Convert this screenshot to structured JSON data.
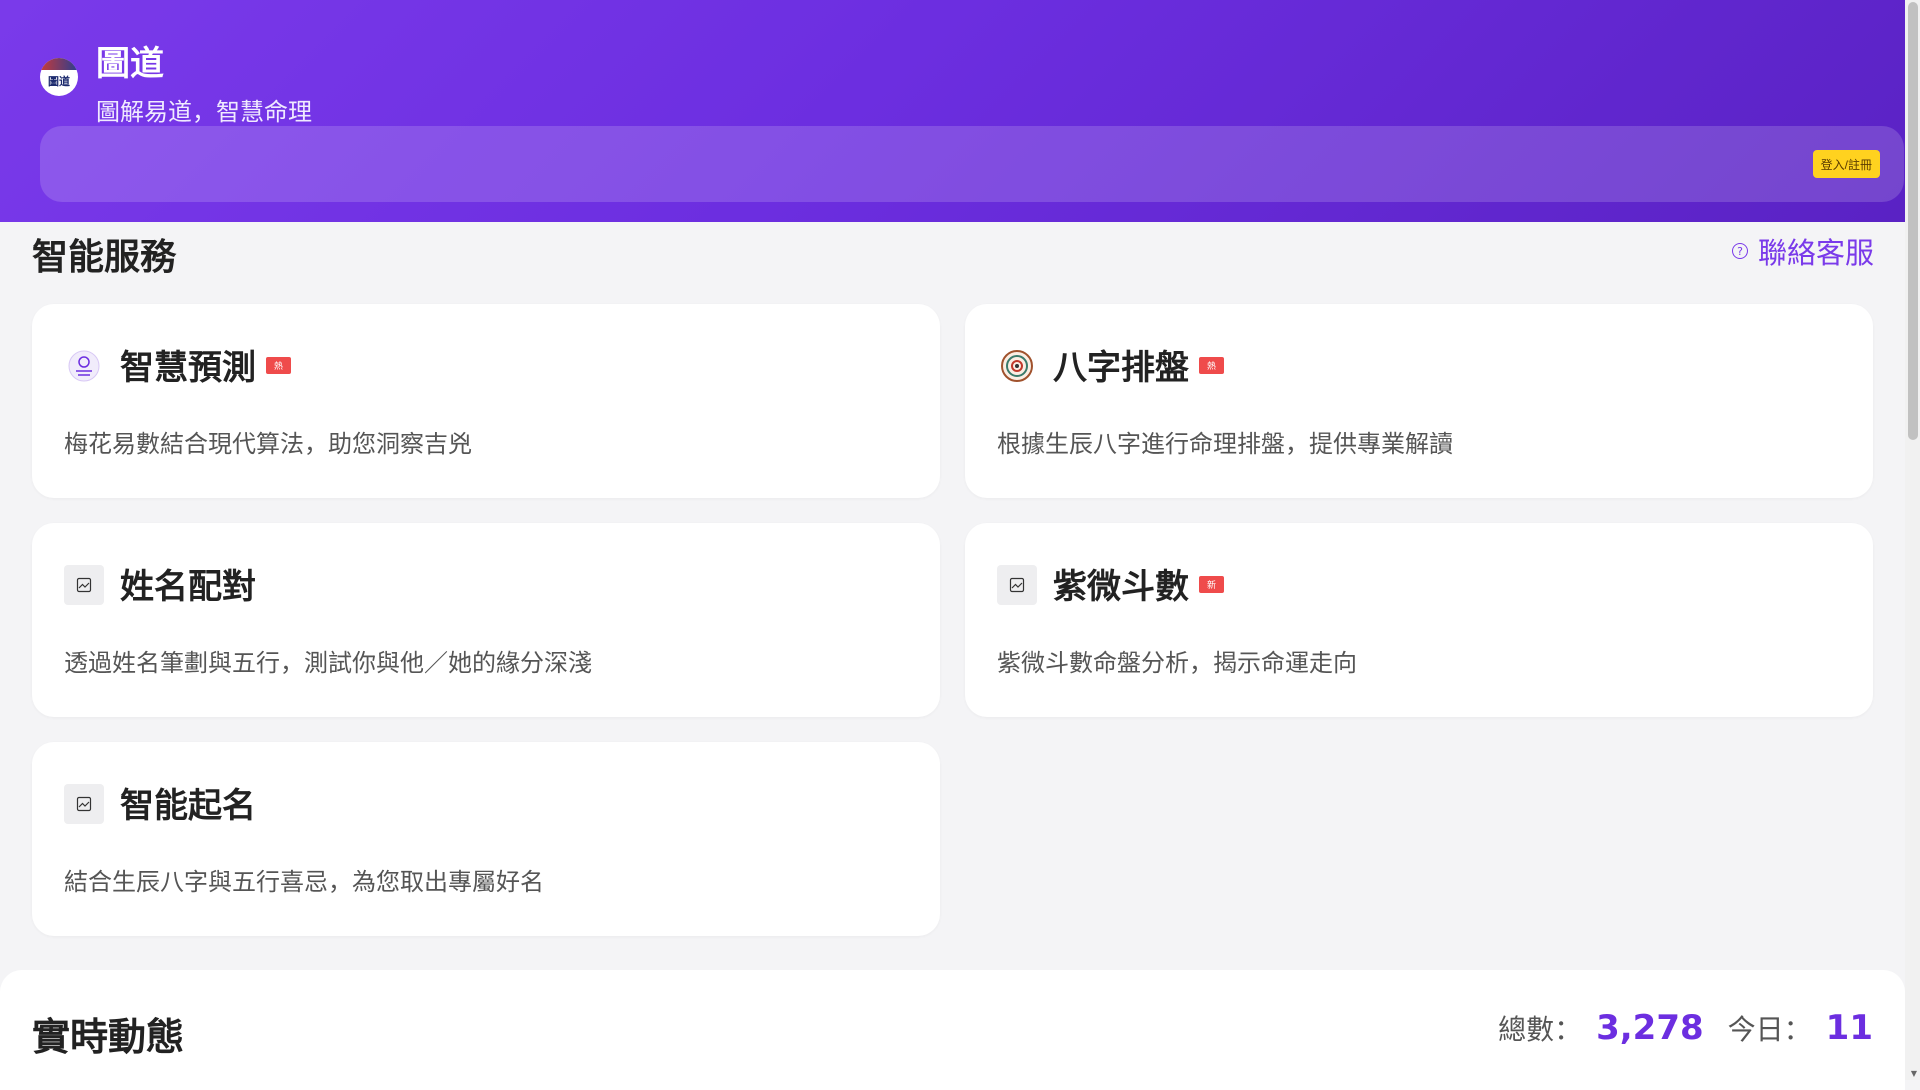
{
  "header": {
    "logo_text": "圖道",
    "title": "圖道",
    "subtitle": "圖解易道，智慧命理",
    "login_label": "登入/註冊"
  },
  "section": {
    "title": "智能服務",
    "support_label": "聯絡客服"
  },
  "services": [
    {
      "title": "智慧預測",
      "badge": "熱",
      "desc": "梅花易數結合現代算法，助您洞察吉兇",
      "icon": "wheel-icon"
    },
    {
      "title": "八字排盤",
      "badge": "熱",
      "desc": "根據生辰八字進行命理排盤，提供專業解讀",
      "icon": "compass-icon"
    },
    {
      "title": "姓名配對",
      "badge": "",
      "desc": "透過姓名筆劃與五行，測試你與他／她的緣分深淺",
      "icon": "image-icon"
    },
    {
      "title": "紫微斗數",
      "badge": "新",
      "desc": "紫微斗數命盤分析，揭示命運走向",
      "icon": "image-icon"
    },
    {
      "title": "智能起名",
      "badge": "",
      "desc": "結合生辰八字與五行喜忌，為您取出專屬好名",
      "icon": "image-icon"
    }
  ],
  "live": {
    "title": "實時動態",
    "total_label": "總數：",
    "total_value": "3,278",
    "today_label": "今日：",
    "today_value": "11"
  },
  "colors": {
    "accent": "#7a3aea",
    "badge": "#ef4b4b",
    "login": "#ffd21f"
  }
}
